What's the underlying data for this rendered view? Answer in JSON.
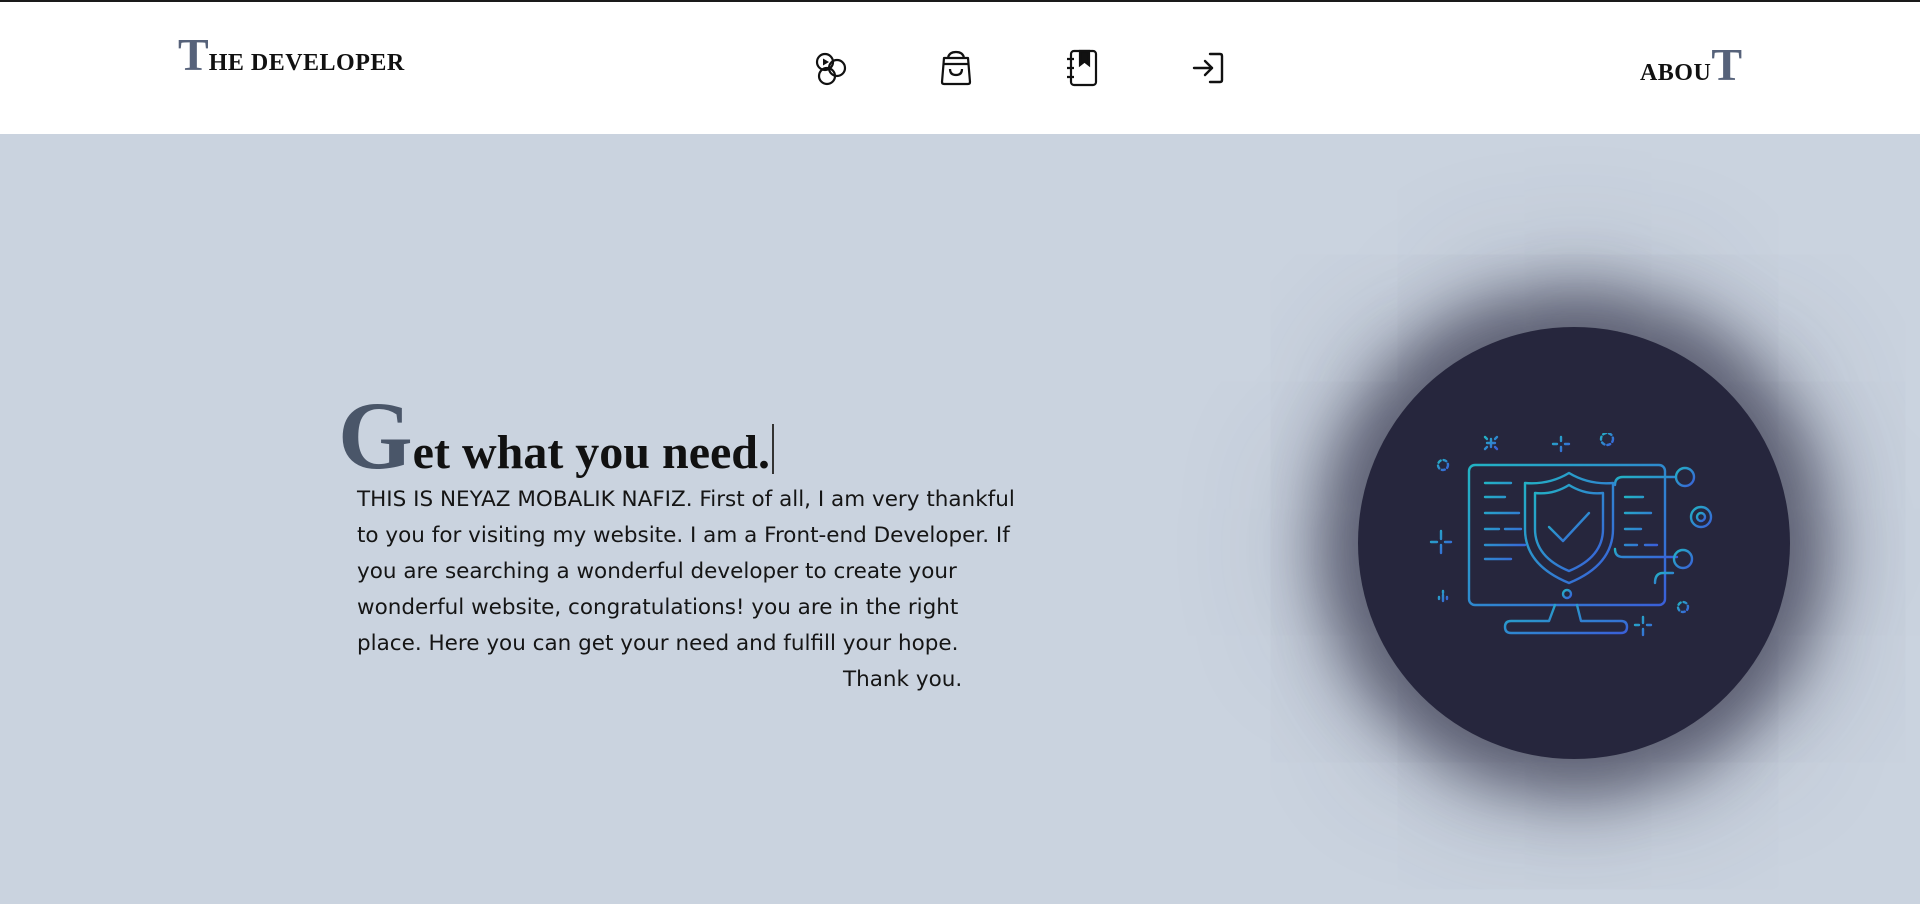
{
  "header": {
    "logo": {
      "initial": "T",
      "rest": "HE DEVELOPER"
    },
    "nav": [
      {
        "name": "media-icon"
      },
      {
        "name": "shopping-bag-icon"
      },
      {
        "name": "bookmark-book-icon"
      },
      {
        "name": "login-icon"
      }
    ],
    "about": {
      "rest": "ABOU",
      "final": "T"
    }
  },
  "hero": {
    "title_initial": "G",
    "title_rest": "et what you need.",
    "text": "THIS IS NEYAZ MOBALIK NAFIZ. First of all, I am very thankful to you for visiting my website. I am a Front-end Developer. If you are searching a wonderful developer to create your wonderful website, congratulations! you are in the right place. Here you can get your need and fulfill your hope.",
    "signoff": "Thank you."
  },
  "illustration": {
    "name": "security-monitor-illustration",
    "icon": "shield-check-icon",
    "colors": {
      "circle": "#26263d",
      "gradient_start": "#22b3c4",
      "gradient_end": "#3a5fd9"
    }
  },
  "colors": {
    "background": "#cad3df",
    "header_bg": "#ffffff",
    "accent_initial": "#56627a"
  }
}
